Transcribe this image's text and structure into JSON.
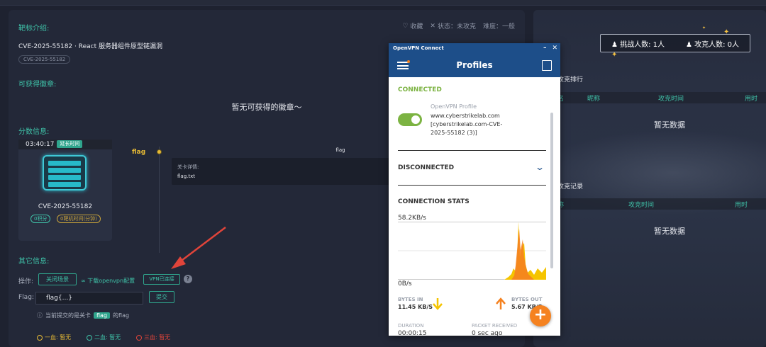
{
  "left": {
    "target_intro_label": "靶标介绍:",
    "favorite": "收藏",
    "status": "状态：未攻克",
    "difficulty": "难度：一般",
    "target_title": "CVE-2025-55182 · React 服务器组件原型链漏洞",
    "tag": "CVE-2025-55182",
    "badges_label": "可获得徽章:",
    "no_badges": "暂无可获得的徽章～",
    "score_label": "分数信息:",
    "timer": "03:40:17",
    "extend_time": "延长时间",
    "card_name": "CVE-2025-55182",
    "score_pill": "0积分",
    "time_pill": "0靶机时间(分钟)",
    "flag_title": "flag",
    "flag_header": "flag",
    "detail_label": "关卡详情:",
    "detail_file": "flag.txt",
    "other_label": "其它信息:",
    "op_label": "操作:",
    "close_scene": "关闭场景",
    "download_vpn": "下载openvpn配置",
    "vpn_connected": "VPN已连接",
    "help": "?",
    "flag_label": "Flag:",
    "flag_value": "flag{...}",
    "submit": "提交",
    "hint_prefix": "当前提交的是关卡",
    "hint_flag": "flag",
    "hint_suffix": "的flag",
    "blood1": "一血: 暂无",
    "blood2": "二血: 暂无",
    "blood3": "三血: 暂无",
    "colors": {
      "accent": "#3fc2a8",
      "gold": "#e5b935",
      "red": "#e0443a"
    }
  },
  "right": {
    "challengers": "挑战人数: 1人",
    "solvers": "攻克人数: 0人",
    "ranking_title": "攻克排行",
    "ranking_cols": [
      "名",
      "昵称",
      "攻克时间",
      "用时"
    ],
    "ranking_empty": "暂无数据",
    "records_title": "攻克记录",
    "records_cols": [
      "称",
      "攻克时间",
      "用时"
    ],
    "records_empty": "暂无数据"
  },
  "openvpn": {
    "window_title": "OpenVPN Connect",
    "header_title": "Profiles",
    "connected_label": "CONNECTED",
    "profile_name": "OpenVPN Profile",
    "profile_host": "www.cyberstrikelab.com",
    "profile_detail_1": "[cyberstrikelab.com-CVE-",
    "profile_detail_2": "2025-55182 (3)]",
    "disconnected_label": "DISCONNECTED",
    "stats_label": "CONNECTION STATS",
    "speed_max": "58.2KB/s",
    "speed_min": "0B/s",
    "bytes_in_label": "BYTES IN",
    "bytes_in_value": "11.45 KB/S",
    "bytes_out_label": "BYTES OUT",
    "bytes_out_value": "5.67 KB/S",
    "duration_label": "DURATION",
    "duration_value": "00:00:15",
    "packet_label": "PACKET RECEIVED",
    "packet_value": "0 sec ago",
    "colors": {
      "brand": "#1d4e89",
      "connected": "#7cb342",
      "orange": "#f58220",
      "yellow": "#f5c400"
    }
  }
}
